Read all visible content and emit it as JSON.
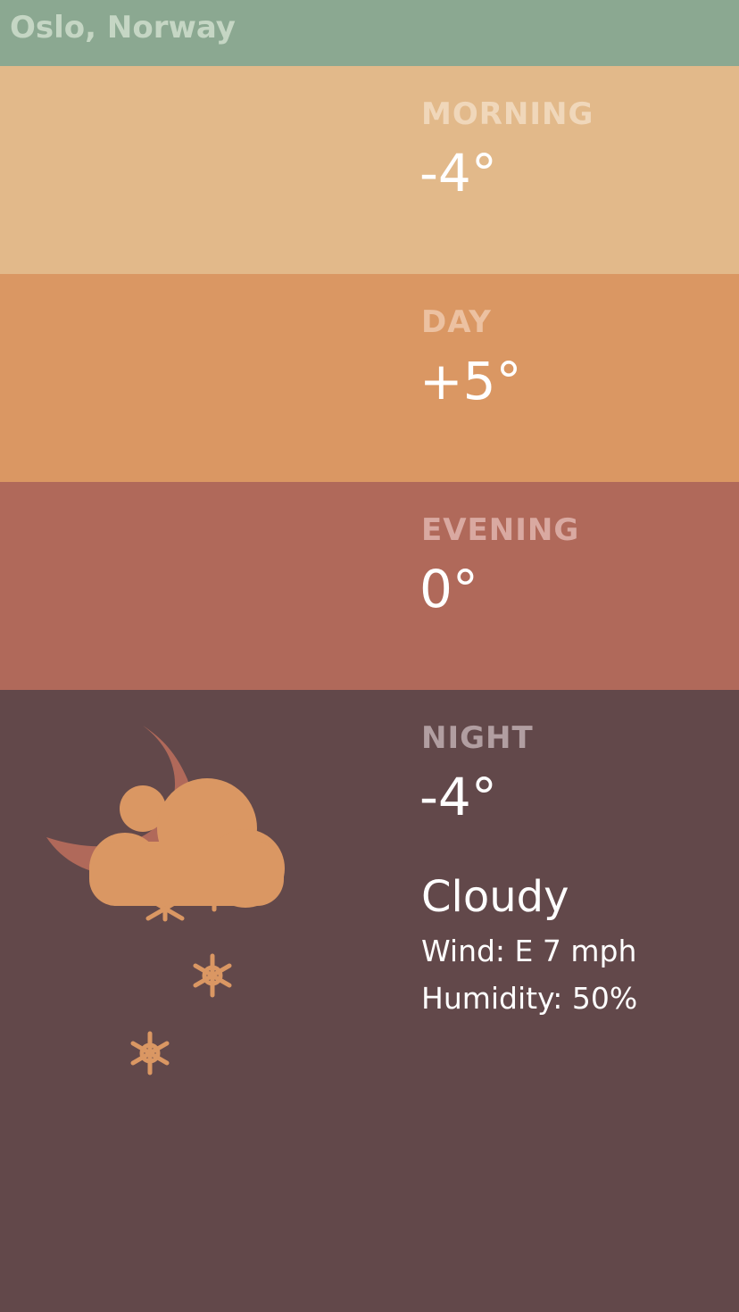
{
  "header": {
    "location": "Oslo, Norway"
  },
  "panels": [
    {
      "period": "MORNING",
      "temperature": "-4°",
      "color": "#e2b98a"
    },
    {
      "period": "DAY",
      "temperature": "+5°",
      "color": "#da9763"
    },
    {
      "period": "EVENING",
      "temperature": "0°",
      "color": "#b0695a"
    },
    {
      "period": "NIGHT",
      "temperature": "-4°",
      "color": "#62484a"
    }
  ],
  "night": {
    "condition": "Cloudy",
    "wind": "Wind: E 7 mph",
    "humidity": "Humidity: 50%",
    "icon": "moon-cloud-snow-icon"
  },
  "colors": {
    "header": "#8ba891",
    "accent_orange": "#da9763",
    "moon": "#b0695a"
  }
}
